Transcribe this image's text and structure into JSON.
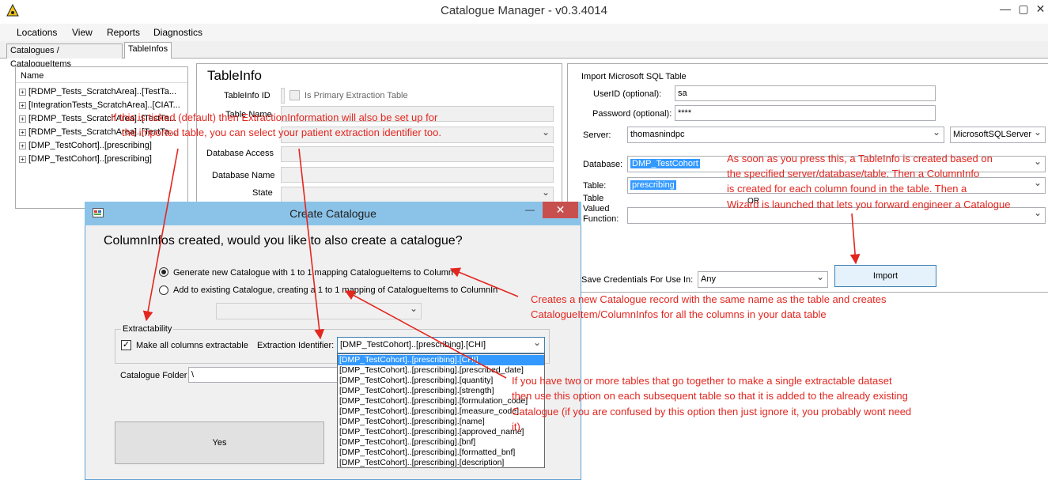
{
  "window": {
    "title": "Catalogue Manager - v0.3.4014",
    "minimize": "—",
    "maximize": "▢",
    "close": "✕"
  },
  "menu": [
    "Locations",
    "View",
    "Reports",
    "Diagnostics"
  ],
  "tabs": [
    "Catalogues / CatalogueItems",
    "TableInfos"
  ],
  "tree": {
    "header": "Name",
    "items": [
      "[RDMP_Tests_ScratchArea]..[TestTa...",
      "[IntegrationTests_ScratchArea]..[CIAT...",
      "[RDMP_Tests_ScratchArea]..[TestTa...",
      "[RDMP_Tests_ScratchArea]..[TestTa...",
      "[DMP_TestCohort]..[prescribing]",
      "[DMP_TestCohort]..[prescribing]"
    ]
  },
  "tableinfo": {
    "heading": "TableInfo",
    "id_label": "TableInfo ID",
    "primary_label": "Is Primary Extraction Table",
    "name_label": "Table Name",
    "db_access_label": "Database Access",
    "db_name_label": "Database Name",
    "state_label": "State"
  },
  "import": {
    "heading": "Import Microsoft SQL Table",
    "userid_label": "UserID (optional):",
    "userid_value": "sa",
    "password_label": "Password (optional):",
    "password_value": "****",
    "server_label": "Server:",
    "server_value": "thomasnindpc",
    "server_type": "MicrosoftSQLServer",
    "database_label": "Database:",
    "database_value": "DMP_TestCohort",
    "table_label": "Table:",
    "table_value": "prescribing",
    "tvf_label_1": "Table",
    "tvf_label_2": "Valued",
    "tvf_label_3": "Function:",
    "or_text": "OR",
    "save_label": "Save Credentials For Use In:",
    "save_value": "Any",
    "import_button": "Import"
  },
  "dialog": {
    "title": "Create Catalogue",
    "close": "✕",
    "question": "ColumnInfos created, would you like to also create a catalogue?",
    "option1": "Generate new Catalogue with 1 to 1 mapping CatalogueItems to ColumnInfos",
    "option2": "Add to existing Catalogue, creating a 1 to 1 mapping of CatalogueItems to ColumnInfos",
    "extractability_legend": "Extractability",
    "make_extractable": "Make all columns extractable",
    "extraction_identifier_label": "Extraction Identifier:",
    "extraction_identifier_value": "[DMP_TestCohort]..[prescribing].[CHI]",
    "catalogue_folder_label": "Catalogue Folder",
    "catalogue_folder_value": "\\",
    "yes_button": "Yes",
    "dropdown_items": [
      "[DMP_TestCohort]..[prescribing].[CHI]",
      "[DMP_TestCohort]..[prescribing].[prescribed_date]",
      "[DMP_TestCohort]..[prescribing].[quantity]",
      "[DMP_TestCohort]..[prescribing].[strength]",
      "[DMP_TestCohort]..[prescribing].[formulation_code]",
      "[DMP_TestCohort]..[prescribing].[measure_code]",
      "[DMP_TestCohort]..[prescribing].[name]",
      "[DMP_TestCohort]..[prescribing].[approved_name]",
      "[DMP_TestCohort]..[prescribing].[bnf]",
      "[DMP_TestCohort]..[prescribing].[formatted_bnf]",
      "[DMP_TestCohort]..[prescribing].[description]"
    ]
  },
  "annotations": {
    "tick_1": "If this is ticked (default) then ExtractionInformation will also be set up for",
    "tick_2": "the imported table, you can select your patient extraction identifier too.",
    "press_1": "As soon as you press this, a TableInfo is created based on",
    "press_2": "the specified server/database/table.  Then a ColumnInfo",
    "press_3": "is created for each column found in the table.  Then a",
    "press_4": "Wizard is launched that lets you forward engineer a Catalogue",
    "new_1": "Creates a new Catalogue record with the same name as the table and creates",
    "new_2": "CatalogueItem/ColumnInfos for all the columns in your data table",
    "multi_1": "If you have two or more tables that go together to make a single extractable dataset",
    "multi_2": "then use this option on each subsequent table so that it is added to the already existing",
    "multi_3": "Catalogue (if you are confused by this option then just ignore it, you probably wont need",
    "multi_4": "it)."
  },
  "colors": {
    "annotation": "#e3261f",
    "selection": "#3399ff",
    "dialog_title": "#8bc3e8",
    "close_button": "#c7504f"
  }
}
